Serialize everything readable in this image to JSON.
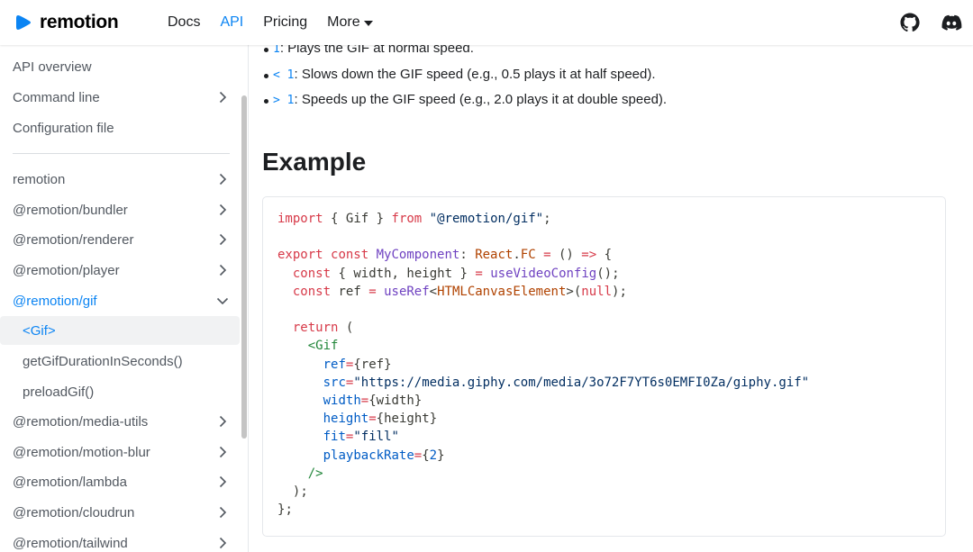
{
  "navbar": {
    "brand": "remotion",
    "links": [
      "Docs",
      "API",
      "Pricing"
    ],
    "more": "More"
  },
  "sidebar": {
    "top": [
      "API overview",
      "Command line",
      "Configuration file"
    ],
    "packages": [
      "remotion",
      "@remotion/bundler",
      "@remotion/renderer",
      "@remotion/player",
      "@remotion/gif",
      "<Gif>",
      "getGifDurationInSeconds()",
      "preloadGif()",
      "@remotion/media-utils",
      "@remotion/motion-blur",
      "@remotion/lambda",
      "@remotion/cloudrun",
      "@remotion/tailwind"
    ]
  },
  "content": {
    "bullets": [
      {
        "code": "1",
        "text": ": Plays the GIF at normal speed."
      },
      {
        "code": "< 1",
        "text": ": Slows down the GIF speed (e.g., 0.5 plays it at half speed)."
      },
      {
        "code": "> 1",
        "text": ": Speeds up the GIF speed (e.g., 2.0 plays it at double speed)."
      }
    ],
    "heading": "Example",
    "code": [
      "import { Gif } from \"@remotion/gif\";",
      "",
      "export const MyComponent: React.FC = () => {",
      "  const { width, height } = useVideoConfig();",
      "  const ref = useRef<HTMLCanvasElement>(null);",
      "",
      "  return (",
      "    <Gif",
      "      ref={ref}",
      "      src=\"https://media.giphy.com/media/3o72F7YT6s0EMFI0Za/giphy.gif\"",
      "      width={width}",
      "      height={height}",
      "      fit=\"fill\"",
      "      playbackRate={2}",
      "    />",
      "  );",
      "};"
    ]
  },
  "colors": {
    "accent": "#0b84f3",
    "text": "#1c1e21",
    "sidebar_text": "#525860"
  }
}
